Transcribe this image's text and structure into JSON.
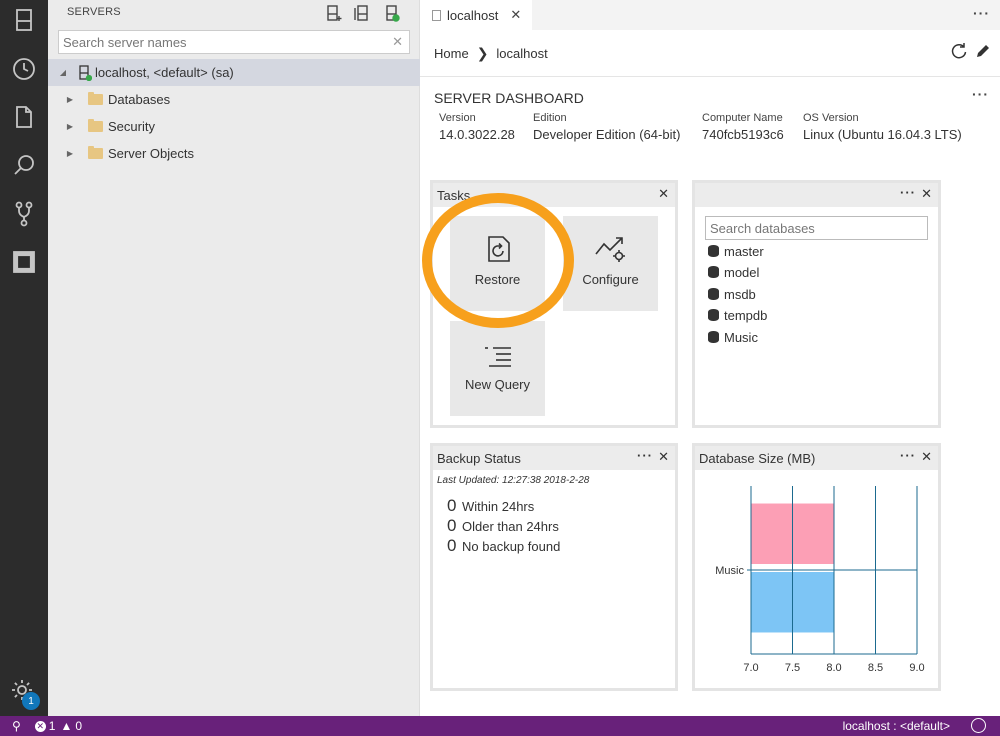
{
  "activity_bar": {
    "icons": [
      "servers-icon",
      "history-icon",
      "file-icon",
      "search-icon",
      "source-control-icon",
      "extensions-icon"
    ],
    "settings_badge": "1"
  },
  "sidebar": {
    "title": "SERVERS",
    "search_placeholder": "Search server names",
    "tree": [
      {
        "label": "localhost, <default> (sa)",
        "level": 0,
        "selected": true
      },
      {
        "label": "Databases",
        "level": 1
      },
      {
        "label": "Security",
        "level": 1
      },
      {
        "label": "Server Objects",
        "level": 1
      }
    ]
  },
  "editor": {
    "tab": {
      "label": "localhost"
    },
    "breadcrumb": {
      "home": "Home",
      "current": "localhost"
    }
  },
  "dashboard": {
    "title": "SERVER DASHBOARD",
    "properties": [
      {
        "key": "Version",
        "value": "14.0.3022.28"
      },
      {
        "key": "Edition",
        "value": "Developer Edition (64-bit)"
      },
      {
        "key": "Computer Name",
        "value": "740fcb5193c6"
      },
      {
        "key": "OS Version",
        "value": "Linux (Ubuntu 16.04.3 LTS)"
      }
    ]
  },
  "tasks": {
    "title": "Tasks",
    "items": [
      {
        "label": "Restore"
      },
      {
        "label": "Configure"
      },
      {
        "label": "New Query"
      }
    ]
  },
  "databases": {
    "search_placeholder": "Search databases",
    "items": [
      "master",
      "model",
      "msdb",
      "tempdb",
      "Music"
    ]
  },
  "backup_status": {
    "title": "Backup Status",
    "last_updated": "Last Updated: 12:27:38 2018-2-28",
    "rows": [
      {
        "count": "0",
        "label": "Within 24hrs"
      },
      {
        "count": "0",
        "label": "Older than 24hrs"
      },
      {
        "count": "0",
        "label": "No backup found"
      }
    ]
  },
  "chart_data": {
    "type": "bar",
    "title": "Database Size (MB)",
    "orientation": "horizontal",
    "categories": [
      "Music"
    ],
    "series": [
      {
        "values": [
          8.0
        ],
        "color": "#fc9fb5"
      },
      {
        "values": [
          8.0
        ],
        "color": "#7dc5f5"
      }
    ],
    "xlim": [
      7.0,
      9.0
    ],
    "xticks": [
      "7.0",
      "7.5",
      "8.0",
      "8.5",
      "9.0"
    ],
    "grid": true
  },
  "status_bar": {
    "errors": "1",
    "warnings": "0",
    "connection": "localhost : <default>"
  },
  "colors": {
    "activity_bar": "#2c2c2c",
    "status_bar": "#68217a",
    "highlight": "#f7a01c"
  }
}
